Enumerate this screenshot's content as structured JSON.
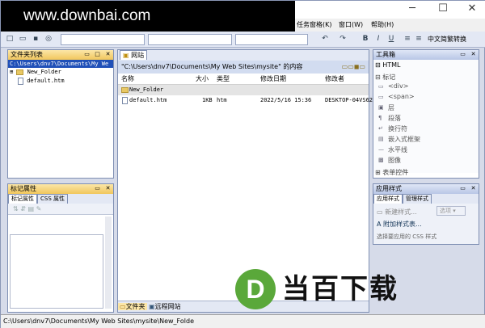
{
  "watermark": "www.downbai.com",
  "window": {
    "minimize": "─",
    "maximize": "☐",
    "close": "✕"
  },
  "menus": [
    "任务窗格(K)",
    "窗口(W)",
    "帮助(H)"
  ],
  "toolbar": {
    "lang": "中文简繁转换"
  },
  "folder_list": {
    "title": "文件夹列表",
    "root": "C:\\Users\\dnv7\\Documents\\My We",
    "items": [
      "New_Folder",
      "default.htm"
    ]
  },
  "tag_props": {
    "title": "标记属性",
    "tabs": [
      "标记属性",
      "CSS 属性"
    ]
  },
  "website": {
    "tab": "网站",
    "path": "\"C:\\Users\\dnv7\\Documents\\My Web Sites\\mysite\" 的内容",
    "columns": [
      "名称",
      "大小",
      "类型",
      "修改日期",
      "修改者"
    ],
    "rows": [
      {
        "name": "New_Folder",
        "size": "",
        "type": "",
        "date": "",
        "by": ""
      },
      {
        "name": "default.htm",
        "size": "1KB",
        "type": "htm",
        "date": "2022/5/16 15:36",
        "by": "DESKTOP-04VS62"
      }
    ],
    "bottom_tabs": [
      "文件夹",
      "远程网站"
    ]
  },
  "toolbox": {
    "title": "工具箱",
    "groups": [
      "HTML",
      "标记"
    ],
    "items": [
      "<div>",
      "<span>",
      "层",
      "段落",
      "换行符",
      "嵌入式框架",
      "水平线",
      "图像"
    ],
    "more": "表单控件"
  },
  "styles": {
    "title": "应用样式",
    "tabs": [
      "应用样式",
      "管理样式"
    ],
    "new_style": "新建样式...",
    "options": "选项",
    "attach": "附加样式表...",
    "hint": "选择要应用的 CSS 样式"
  },
  "status": "C:\\Users\\dnv7\\Documents\\My Web Sites\\mysite\\New_Folde",
  "brand": {
    "letter": "D",
    "text": "当百下载",
    "color": "#5aa83a"
  }
}
